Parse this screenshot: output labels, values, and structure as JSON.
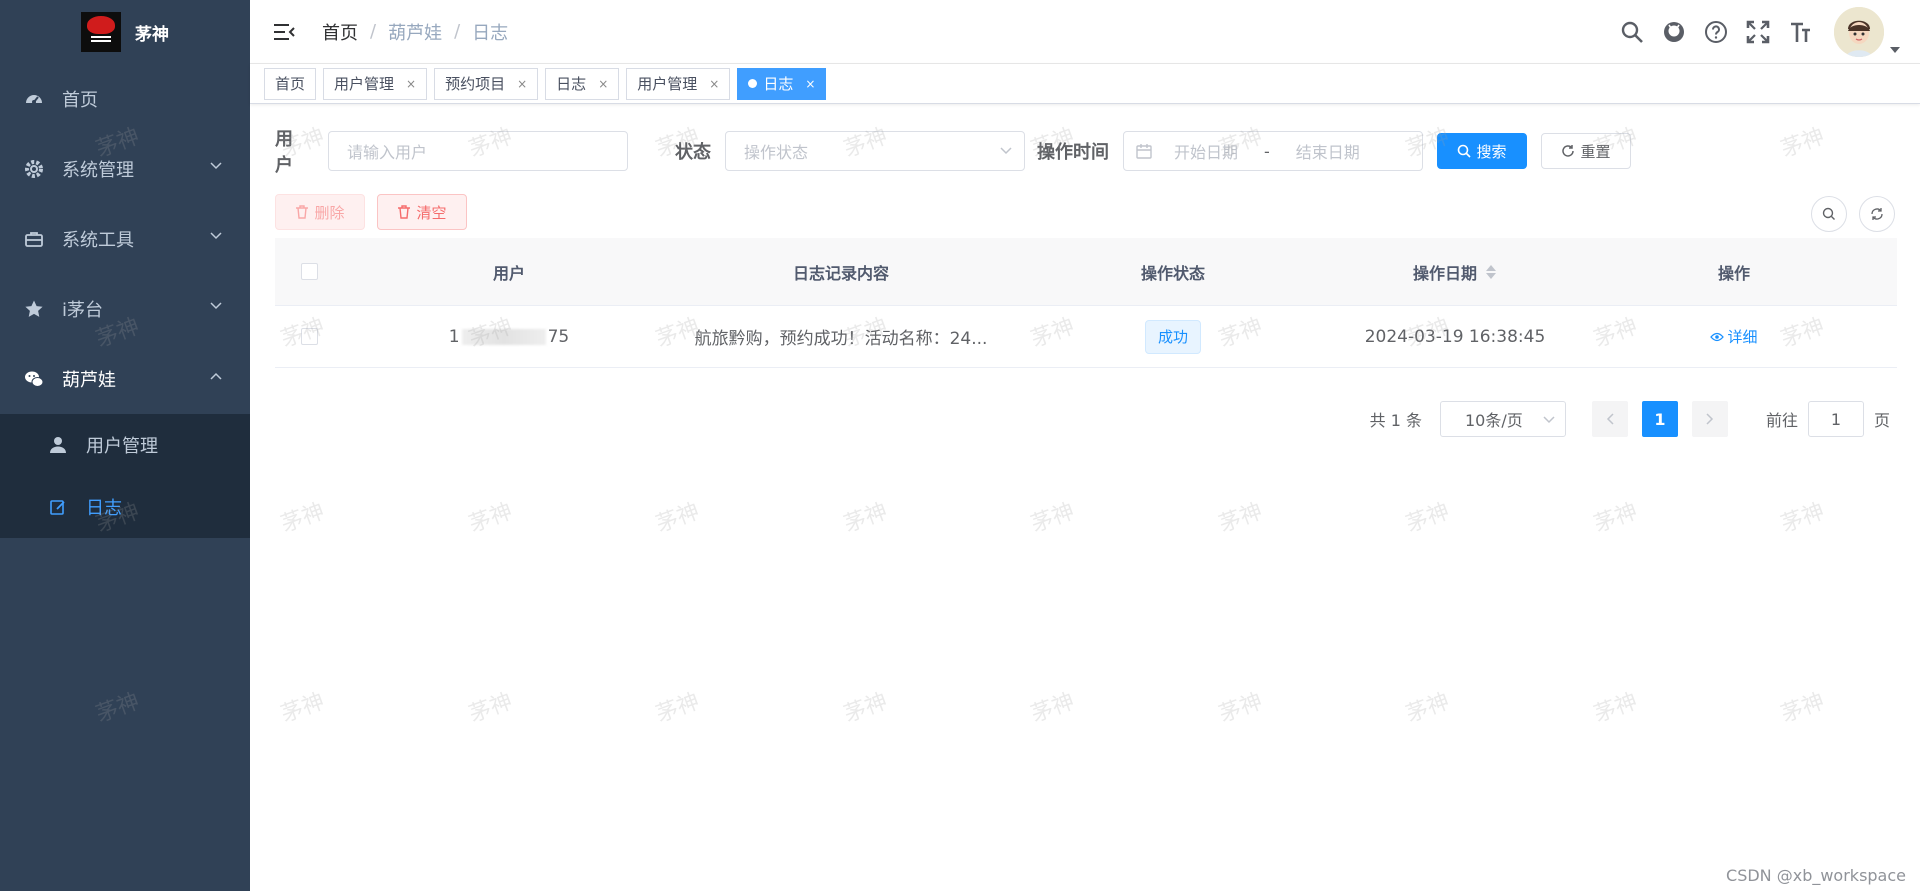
{
  "sidebar": {
    "logo_title": "茅神",
    "items": [
      {
        "label": "首页",
        "icon": "dashboard-icon"
      },
      {
        "label": "系统管理",
        "icon": "gear-icon"
      },
      {
        "label": "系统工具",
        "icon": "toolbox-icon"
      },
      {
        "label": "i茅台",
        "icon": "star-icon"
      },
      {
        "label": "葫芦娃",
        "icon": "wechat-icon"
      }
    ],
    "sub_items": [
      {
        "label": "用户管理",
        "icon": "user-icon"
      },
      {
        "label": "日志",
        "icon": "edit-icon"
      }
    ]
  },
  "breadcrumb": [
    "首页",
    "葫芦娃",
    "日志"
  ],
  "tags": [
    {
      "label": "首页"
    },
    {
      "label": "用户管理"
    },
    {
      "label": "预约项目"
    },
    {
      "label": "日志"
    },
    {
      "label": "用户管理"
    },
    {
      "label": "日志"
    }
  ],
  "tag_close": "×",
  "search": {
    "user_label": "用户",
    "user_placeholder": "请输入用户",
    "status_label": "状态",
    "status_placeholder": "操作状态",
    "time_label": "操作时间",
    "start_placeholder": "开始日期",
    "range_sep": "-",
    "end_placeholder": "结束日期",
    "search_btn": "搜索",
    "reset_btn": "重置"
  },
  "toolbar": {
    "delete_btn": "删除",
    "clear_btn": "清空"
  },
  "table": {
    "columns": [
      "用户",
      "日志记录内容",
      "操作状态",
      "操作日期",
      "操作"
    ],
    "rows": [
      {
        "user_prefix": "1",
        "user_suffix": "75",
        "content": "航旅黔购，预约成功！活动名称：24...",
        "status": "成功",
        "date": "2024-03-19 16:38:45",
        "action": "详细"
      }
    ]
  },
  "pagination": {
    "total": "共 1 条",
    "page_size": "10条/页",
    "current": "1",
    "goto_label": "前往",
    "goto_value": "1",
    "page_suffix": "页"
  },
  "watermark_text": "茅神",
  "credit": "CSDN @xb_workspace",
  "colors": {
    "sidebar_bg": "#304156",
    "primary": "#1890ff",
    "danger": "#f56c6c",
    "active_tag": "#409eff"
  }
}
